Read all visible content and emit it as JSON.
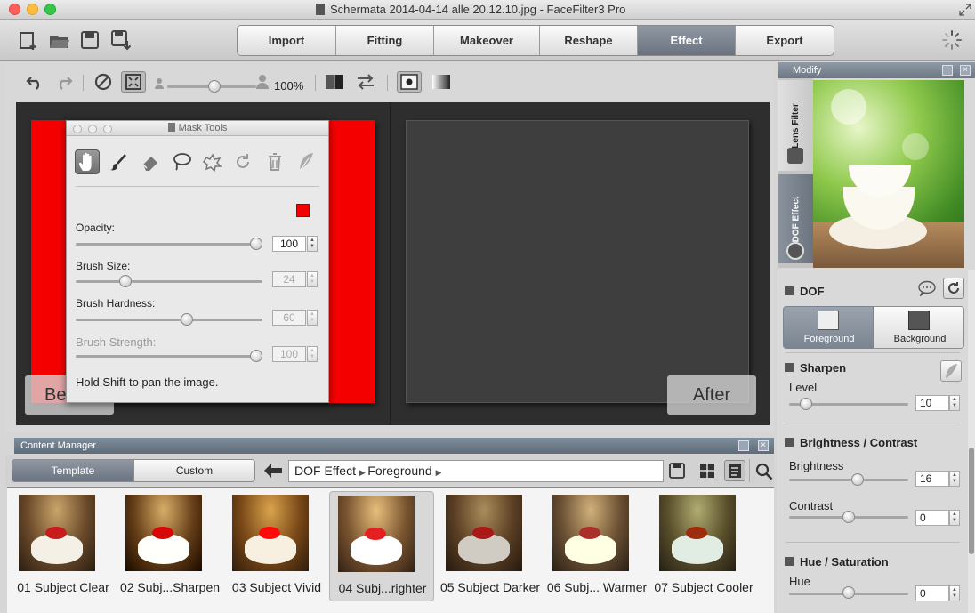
{
  "window": {
    "title": "Schermata 2014-04-14 alle 20.12.10.jpg - FaceFilter3 Pro"
  },
  "colors": {
    "accent_active_tab": "#7b8591",
    "mask_red": "#f40000",
    "close_red": "#fc605b",
    "minimize_yellow": "#fdbc40",
    "zoom_green": "#34c749"
  },
  "toolbar": {
    "file_icons": [
      "new-file-icon",
      "open-folder-icon",
      "save-icon",
      "save-as-icon"
    ],
    "tabs": [
      {
        "label": "Import",
        "active": false
      },
      {
        "label": "Fitting",
        "active": false
      },
      {
        "label": "Makeover",
        "active": false
      },
      {
        "label": "Reshape",
        "active": false
      },
      {
        "label": "Effect",
        "active": true
      },
      {
        "label": "Export",
        "active": false
      }
    ]
  },
  "viewer": {
    "zoom": "100%",
    "before_label": "Be",
    "after_label": "After"
  },
  "mask_tools": {
    "title": "Mask Tools",
    "opacity_label": "Opacity:",
    "opacity_value": "100",
    "opacity_level": 1.0,
    "brush_size_label": "Brush Size:",
    "brush_size_value": "24",
    "brush_size_level": 0.25,
    "brush_hardness_label": "Brush Hardness:",
    "brush_hardness_value": "60",
    "brush_hardness_level": 0.6,
    "brush_strength_label": "Brush Strength:",
    "brush_strength_value": "100",
    "brush_strength_level": 1.0,
    "hint": "Hold Shift to pan the image."
  },
  "content_manager": {
    "title": "Content Manager",
    "tab_template": "Template",
    "tab_custom": "Custom",
    "breadcrumb_1": "DOF Effect",
    "breadcrumb_2": "Foreground",
    "items": [
      {
        "label": "01 Subject Clear",
        "selected": false
      },
      {
        "label": "02 Subj...Sharpen",
        "selected": false
      },
      {
        "label": "03 Subject Vivid",
        "selected": false
      },
      {
        "label": "04 Subj...righter",
        "selected": true
      },
      {
        "label": "05 Subject Darker",
        "selected": false
      },
      {
        "label": "06 Subj... Warmer",
        "selected": false
      },
      {
        "label": "07 Subject Cooler",
        "selected": false
      }
    ]
  },
  "modify": {
    "title": "Modify",
    "vtab_lens": "Lens Filter",
    "vtab_dof": "DOF Effect",
    "dof_title": "DOF",
    "btn_foreground": "Foreground",
    "btn_background": "Background",
    "sharpen_title": "Sharpen",
    "level_label": "Level",
    "level_value": "10",
    "level_fraction": 0.1,
    "bc_title": "Brightness / Contrast",
    "brightness_label": "Brightness",
    "brightness_value": "16",
    "brightness_fraction": 0.58,
    "contrast_label": "Contrast",
    "contrast_value": "0",
    "contrast_fraction": 0.5,
    "hs_title": "Hue / Saturation",
    "hue_label": "Hue",
    "hue_value": "0",
    "hue_fraction": 0.5
  }
}
